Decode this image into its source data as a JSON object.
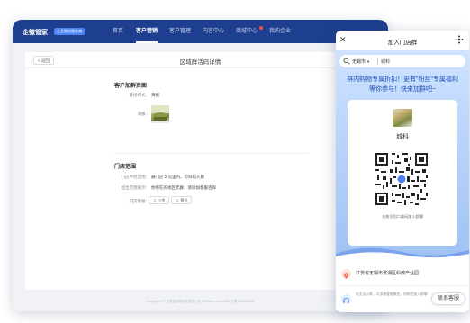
{
  "app": {
    "brand": "企微管家",
    "brand_badge": "企业微信服务商",
    "nav": [
      {
        "label": "首页",
        "active": false
      },
      {
        "label": "客户营销",
        "active": true
      },
      {
        "label": "客户管理",
        "active": false
      },
      {
        "label": "内容中心",
        "active": false
      },
      {
        "label": "商城中心",
        "active": false,
        "dot": true
      },
      {
        "label": "我的企业",
        "active": false
      }
    ],
    "colors": {
      "topbar": "#1e3f8f",
      "accent": "#4f83f5",
      "promo_text": "#1f4fb3"
    }
  },
  "detail": {
    "back": "< 返回",
    "title": "区域群活码详情",
    "section1": "客户加群页面",
    "style_label": "链接样式：",
    "style_value": "海报",
    "poster_label": "海报：",
    "section2": "门店范围",
    "range_label": "门店半径范围：",
    "range_value": "展门店 2 公里内，可扫码入群",
    "outside_label": "超出范围展示：",
    "outside_value": "你所在的地区无群，请添加客服咨询",
    "service_label": "门店客服：",
    "service_btn1": "上传",
    "service_btn2": "预览",
    "footer": "Copyright ©江苏微盛网络科技有限公司 WeShine Co.Ltd 苏ICP备17049232号"
  },
  "phone": {
    "title": "加入门店群",
    "close_icon": "close-icon",
    "city": "无锡市",
    "store": "城科",
    "promo": "群内购物专属折扣！更有“粉丝”专属福利等你参与！快来加群吧~",
    "store_name": "城科",
    "qr_hint": "长按识别二维码加入群聊",
    "address": "江苏省无锡市滨湖区科教产业园",
    "service_text": "若无法入群，可添加客服微信，协助您加入群聊",
    "service_button": "联系客服"
  }
}
